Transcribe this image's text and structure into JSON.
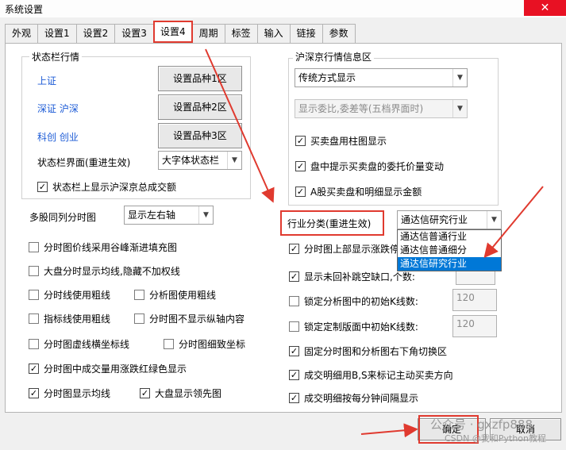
{
  "window": {
    "title": "系统设置",
    "close_glyph": "✕"
  },
  "tabs": [
    "外观",
    "设置1",
    "设置2",
    "设置3",
    "设置4",
    "周期",
    "标签",
    "输入",
    "链接",
    "参数"
  ],
  "status_bar_group": {
    "title": "状态栏行情",
    "rows": [
      {
        "label": "上证",
        "button": "设置品种1区"
      },
      {
        "label": "深证 沪深",
        "button": "设置品种2区"
      },
      {
        "label": "科创 创业",
        "button": "设置品种3区"
      }
    ],
    "interface_label": "状态栏界面(重进生效)",
    "interface_value": "大字体状态栏",
    "show_total_label": "状态栏上显示沪深京总成交额",
    "show_total_checked": true
  },
  "multi_stock": {
    "label": "多股同列分时图",
    "value": "显示左右轴"
  },
  "hs_group": {
    "title": "沪深京行情信息区",
    "display_mode": "传统方式显示",
    "secondary_select": "显示委比,委差等(五档界面时)",
    "options": [
      {
        "label": "买卖盘用柱图显示",
        "checked": true
      },
      {
        "label": "盘中提示买卖盘的委托价量变动",
        "checked": true
      },
      {
        "label": "A股买卖盘和明细显示金额",
        "checked": true
      }
    ]
  },
  "industry": {
    "label": "行业分类(重进生效)",
    "value": "通达信研究行业",
    "options": [
      "通达信普通行业",
      "通达信普通细分",
      "通达信研究行业"
    ],
    "selected_index": 2
  },
  "left_options": [
    {
      "label": "分时图价线采用谷峰渐进填充图",
      "checked": false
    },
    {
      "label": "大盘分时显示均线,隐藏不加权线",
      "checked": false
    }
  ],
  "left_pairs": [
    [
      {
        "label": "分时线使用粗线",
        "checked": false
      },
      {
        "label": "分析图使用粗线",
        "checked": false
      }
    ],
    [
      {
        "label": "指标线使用粗线",
        "checked": false
      },
      {
        "label": "分时图不显示纵轴内容",
        "checked": false
      }
    ],
    [
      {
        "label": "分时图虚线横坐标线",
        "checked": false
      },
      {
        "label": "分时图细致坐标",
        "checked": false
      }
    ]
  ],
  "left_options_2": [
    {
      "label": "分时图中成交量用涨跌红绿色显示",
      "checked": true
    }
  ],
  "left_last_pair": [
    {
      "label": "分时图显示均线",
      "checked": true
    },
    {
      "label": "大盘显示领先图",
      "checked": true
    }
  ],
  "right_options": [
    {
      "label": "分时图上部显示涨跌停",
      "checked": true
    },
    {
      "label": "显示未回补跳空缺口,个数:",
      "checked": true
    },
    {
      "label": "锁定分析图中的初始K线数:",
      "checked": false,
      "spin": "120"
    },
    {
      "label": "锁定定制版面中初始K线数:",
      "checked": false,
      "spin": "120"
    },
    {
      "label": "固定分时图和分析图右下角切换区",
      "checked": true
    },
    {
      "label": "成交明细用B,S来标记主动买卖方向",
      "checked": true
    },
    {
      "label": "成交明细按每分钟间隔显示",
      "checked": true
    }
  ],
  "footer": {
    "ok_label": "确定",
    "cancel_label": "取消"
  },
  "watermark": {
    "text1": "公众号 · gxzfp888",
    "text2": "CSDN @我和Python教程"
  },
  "colors": {
    "annotation_red": "#e03a2f",
    "link_blue": "#1c5bd6",
    "selection_blue": "#0078d7",
    "close_red": "#e81123"
  }
}
